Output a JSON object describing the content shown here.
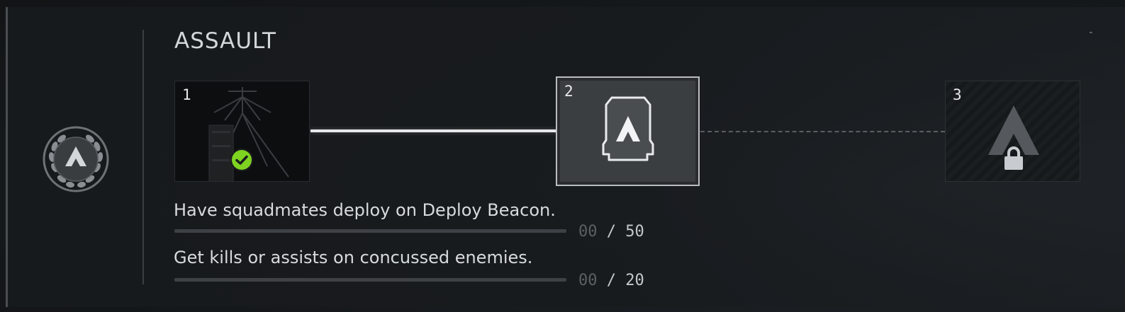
{
  "panel": {
    "title": "ASSAULT",
    "collapse_label": "-"
  },
  "tiers": [
    {
      "number": "1",
      "state": "completed",
      "reward_icon": "deploy-beacon-icon"
    },
    {
      "number": "2",
      "state": "current",
      "reward_icon": "assault-insignia-icon"
    },
    {
      "number": "3",
      "state": "locked",
      "reward_icon": "assault-chevron-icon"
    }
  ],
  "challenges": [
    {
      "text": "Have squadmates deploy on Deploy Beacon.",
      "current": "00",
      "separator": "/",
      "target": "50",
      "progress": 0
    },
    {
      "text": "Get kills or assists on concussed enemies.",
      "current": "00",
      "separator": "/",
      "target": "20",
      "progress": 0
    }
  ],
  "colors": {
    "completed_check": "#7ed321",
    "track": "#3e4246",
    "text": "#d8dbde"
  }
}
